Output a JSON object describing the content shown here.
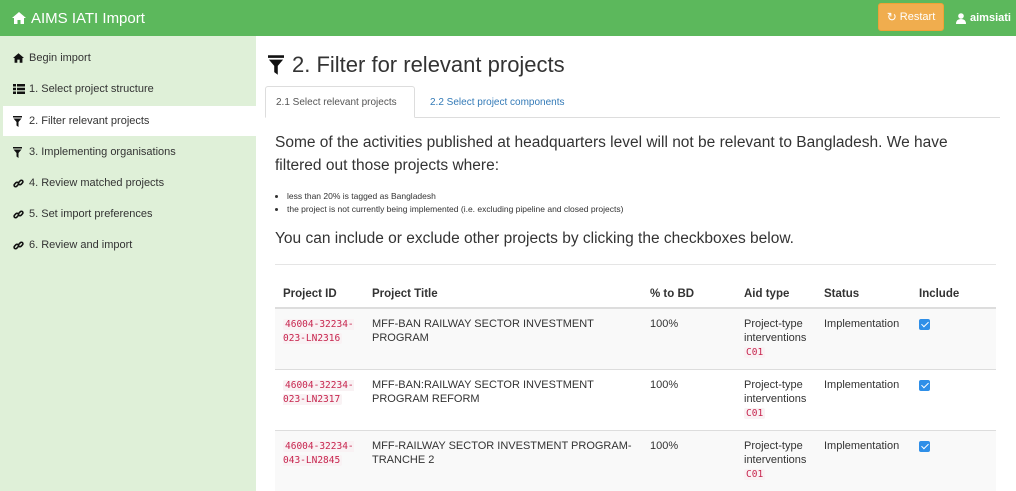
{
  "app": {
    "title": "AIMS IATI Import",
    "user": "aimsiati",
    "restart_label": "Restart"
  },
  "sidebar": {
    "items": [
      {
        "label": "Begin import",
        "icon": "home-icon"
      },
      {
        "label": "1. Select project structure",
        "icon": "list-icon"
      },
      {
        "label": "2. Filter relevant projects",
        "icon": "filter-icon",
        "active": true
      },
      {
        "label": "3. Implementing organisations",
        "icon": "filter-icon"
      },
      {
        "label": "4. Review matched projects",
        "icon": "link-icon"
      },
      {
        "label": "5. Set import preferences",
        "icon": "link-icon"
      },
      {
        "label": "6. Review and import",
        "icon": "link-icon"
      }
    ]
  },
  "main": {
    "title": "2. Filter for relevant projects",
    "tabs": [
      {
        "label": "2.1 Select relevant projects",
        "active": true
      },
      {
        "label": "2.2 Select project components",
        "active": false
      }
    ],
    "lead": "Some of the activities published at headquarters level will not be relevant to Bangladesh. We have filtered out those projects where:",
    "bullets": [
      "less than 20% is tagged as Bangladesh",
      "the project is not currently being implemented (i.e. excluding pipeline and closed projects)"
    ],
    "lead2": "You can include or exclude other projects by clicking the checkboxes below."
  },
  "table": {
    "headers": [
      "Project ID",
      "Project Title",
      "% to BD",
      "Aid type",
      "Status",
      "Include"
    ],
    "rows": [
      {
        "id": "46004-32234-023-LN2316",
        "title": "MFF-BAN RAILWAY SECTOR INVESTMENT PROGRAM",
        "pct": "100%",
        "aid_type": "Project-type interventions",
        "aid_code": "C01",
        "status": "Implementation",
        "include": true
      },
      {
        "id": "46004-32234-023-LN2317",
        "title": "MFF-BAN:RAILWAY SECTOR INVESTMENT PROGRAM REFORM",
        "pct": "100%",
        "aid_type": "Project-type interventions",
        "aid_code": "C01",
        "status": "Implementation",
        "include": true
      },
      {
        "id": "46004-32234-043-LN2845",
        "title": "MFF-RAILWAY SECTOR INVESTMENT PROGRAM-TRANCHE 2",
        "pct": "100%",
        "aid_type": "Project-type interventions",
        "aid_code": "C01",
        "status": "Implementation",
        "include": true
      }
    ]
  },
  "colors": {
    "topbar": "#5cb85c",
    "sidebar": "#dff0d8",
    "restart": "#f0ad4e",
    "link": "#337ab7",
    "code": "#c7254e",
    "checkbox": "#2f8fe8"
  }
}
